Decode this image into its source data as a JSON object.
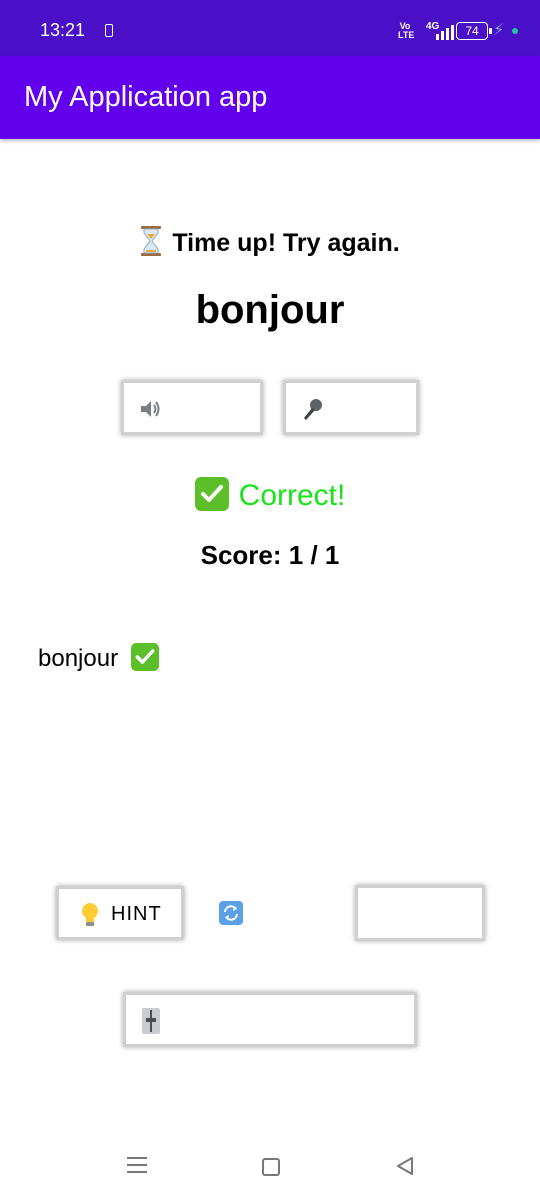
{
  "status_bar": {
    "time": "13:21",
    "volte": "Vo LTE",
    "network": "4G",
    "battery": "74"
  },
  "app_bar": {
    "title": "My Application app"
  },
  "quiz": {
    "timer_message": "Time up! Try again.",
    "word": "bonjour",
    "result_text": "Correct!",
    "result_color": "#1be31b",
    "score_text": "Score: 1 / 1"
  },
  "history": [
    {
      "word": "bonjour",
      "status_icon": "check-mark-icon"
    }
  ],
  "controls": {
    "speak_icon": "speaker-icon",
    "mic_icon": "microphone-icon",
    "hint_label": "HINT",
    "hint_icon": "light-bulb-icon",
    "refresh_icon": "refresh-icon",
    "level_icon": "level-slider-icon"
  },
  "colors": {
    "status_bar": "#4a10c8",
    "app_bar": "#6200ee",
    "check_green": "#5cbf2a"
  }
}
